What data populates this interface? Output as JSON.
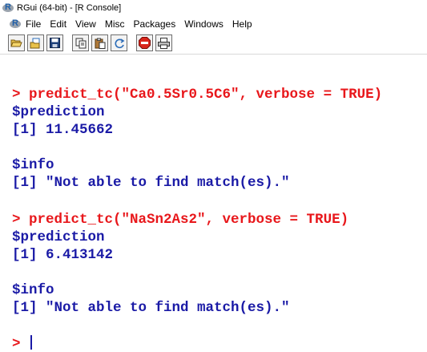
{
  "window": {
    "title": "RGui (64-bit) - [R Console]",
    "app_icon": "r-logo-icon"
  },
  "menu": {
    "items": [
      "File",
      "Edit",
      "View",
      "Misc",
      "Packages",
      "Windows",
      "Help"
    ]
  },
  "toolbar": {
    "buttons": [
      "open-script-icon",
      "load-workspace-icon",
      "save-workspace-icon",
      "copy-icon",
      "paste-icon",
      "copy-paste-icon",
      "stop-icon",
      "print-icon"
    ]
  },
  "console": {
    "lines": [
      {
        "type": "cmd",
        "text": "> predict_tc(\"Ca0.5Sr0.5C6\", verbose = TRUE)"
      },
      {
        "type": "out",
        "text": "$prediction"
      },
      {
        "type": "out",
        "text": "[1] 11.45662"
      },
      {
        "type": "out",
        "text": "$info"
      },
      {
        "type": "out",
        "text": "[1] \"Not able to find match(es).\""
      },
      {
        "type": "cmd",
        "text": "> predict_tc(\"NaSn2As2\", verbose = TRUE)"
      },
      {
        "type": "out",
        "text": "$prediction"
      },
      {
        "type": "out",
        "text": "[1] 6.413142"
      },
      {
        "type": "out",
        "text": "$info"
      },
      {
        "type": "out",
        "text": "[1] \"Not able to find match(es).\""
      }
    ],
    "prompt": ">",
    "colors": {
      "command": "#e8171b",
      "output": "#1a1aa6"
    }
  }
}
